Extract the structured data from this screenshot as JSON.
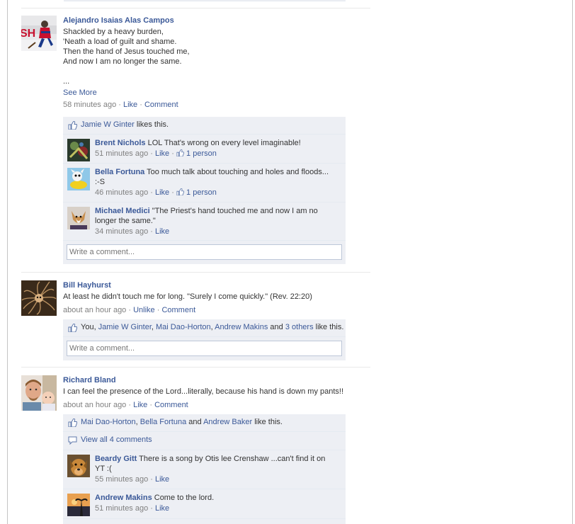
{
  "posts": [
    {
      "author": "Alejandro Isaias Alas Campos",
      "lines": [
        "Shackled by a heavy burden,",
        "'Neath a load of guilt and shame.",
        "Then the hand of Jesus touched me,",
        "And now I am no longer the same."
      ],
      "ellipsis": "...",
      "see_more": "See More",
      "time": "58 minutes ago",
      "like": "Like",
      "comment": "Comment",
      "likes": {
        "user": "Jamie W Ginter",
        "suffix": "likes this."
      },
      "comments": [
        {
          "name": "Brent Nichols",
          "text": "LOL That's wrong on every level imaginable!",
          "time": "51 minutes ago",
          "like": "Like",
          "likes_count": "1 person"
        },
        {
          "name": "Bella Fortuna",
          "text": "Too much talk about touching and holes and floods...",
          "text2": ":-S",
          "time": "46 minutes ago",
          "like": "Like",
          "likes_count": "1 person"
        },
        {
          "name": "Michael Medici",
          "text": "\"The Priest's hand touched me and now I am no",
          "text2": "longer the same.\"",
          "time": "34 minutes ago",
          "like": "Like"
        }
      ],
      "write_placeholder": "Write a comment..."
    },
    {
      "author": "Bill Hayhurst",
      "text": "At least he didn't touch me for long. \"Surely I come quickly.\" (Rev. 22:20)",
      "time": "about an hour ago",
      "unlike": "Unlike",
      "comment": "Comment",
      "likes": {
        "you": "You",
        "users": [
          "Jamie W Ginter",
          "Mai Dao-Horton",
          "Andrew Makins"
        ],
        "and": "and",
        "others": "3 others",
        "suffix": "like this."
      },
      "write_placeholder": "Write a comment..."
    },
    {
      "author": "Richard Bland",
      "text": "I can feel the presence of the Lord...literally, because his hand is down my pants!!",
      "time": "about an hour ago",
      "like": "Like",
      "comment": "Comment",
      "likes": {
        "users": [
          "Mai Dao-Horton",
          "Bella Fortuna"
        ],
        "and": "and",
        "last": "Andrew Baker",
        "suffix": "like this."
      },
      "view_all": "View all 4 comments",
      "comments": [
        {
          "name": "Beardy Gitt",
          "text": "There is a song by Otis lee Crenshaw ...can't find it on",
          "text2": "YT :(",
          "time": "55 minutes ago",
          "like": "Like"
        },
        {
          "name": "Andrew Makins",
          "text": "Come to the lord.",
          "time": "51 minutes ago",
          "like": "Like"
        }
      ]
    }
  ],
  "colors": {
    "link": "#3b5998",
    "ufi_bg": "#edeff4",
    "meta": "#808080"
  },
  "icons": [
    "thumbs-up-icon",
    "speech-bubble-icon"
  ]
}
